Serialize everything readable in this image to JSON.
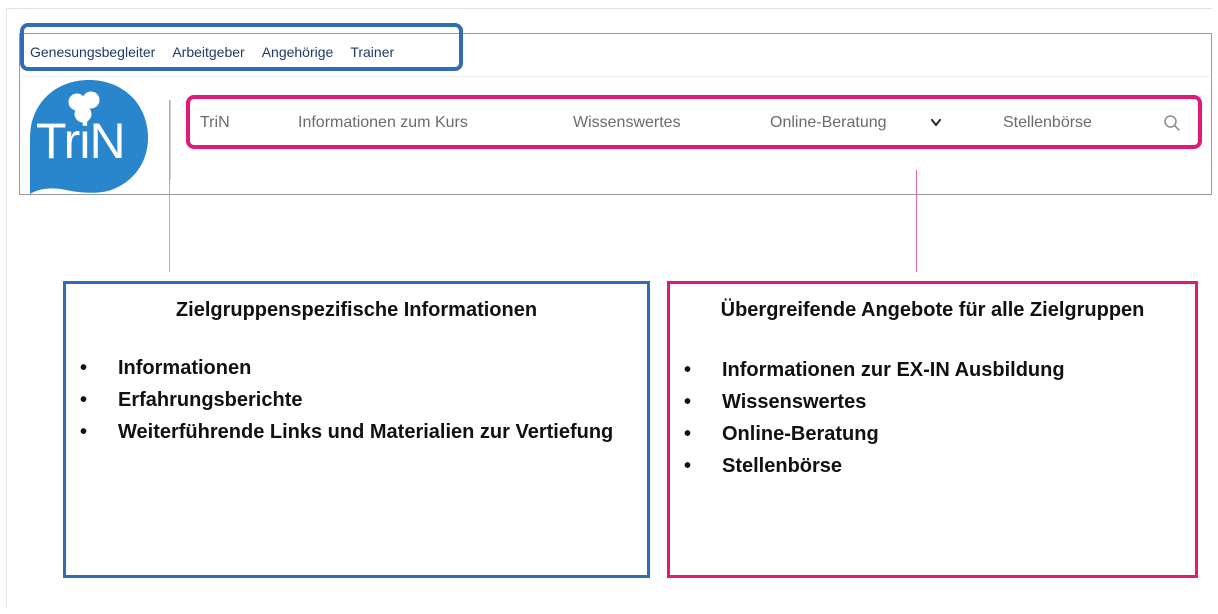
{
  "top_links": [
    "Genesungsbegleiter",
    "Arbeitgeber",
    "Angehörige",
    "Trainer"
  ],
  "logo": {
    "text": "TriN",
    "color": "#2a86cc"
  },
  "main_nav": {
    "items": [
      "TriN",
      "Informationen zum Kurs",
      "Wissenswertes",
      "Online-Beratung",
      "Stellenbörse"
    ],
    "dropdown_icon": "chevron-down-icon",
    "search_icon": "search-icon"
  },
  "colors": {
    "blue": "#2f6db4",
    "pink": "#e0197d"
  },
  "left_box": {
    "title": "Zielgruppenspezifische Informationen",
    "items": [
      "Informationen",
      "Erfahrungsberichte",
      "Weiterführende Links und Materialien zur Vertiefung"
    ]
  },
  "right_box": {
    "title": "Übergreifende Angebote für alle Zielgruppen",
    "items": [
      "Informationen zur EX-IN Ausbildung",
      "Wissenswertes",
      "Online-Beratung",
      "Stellenbörse"
    ]
  }
}
